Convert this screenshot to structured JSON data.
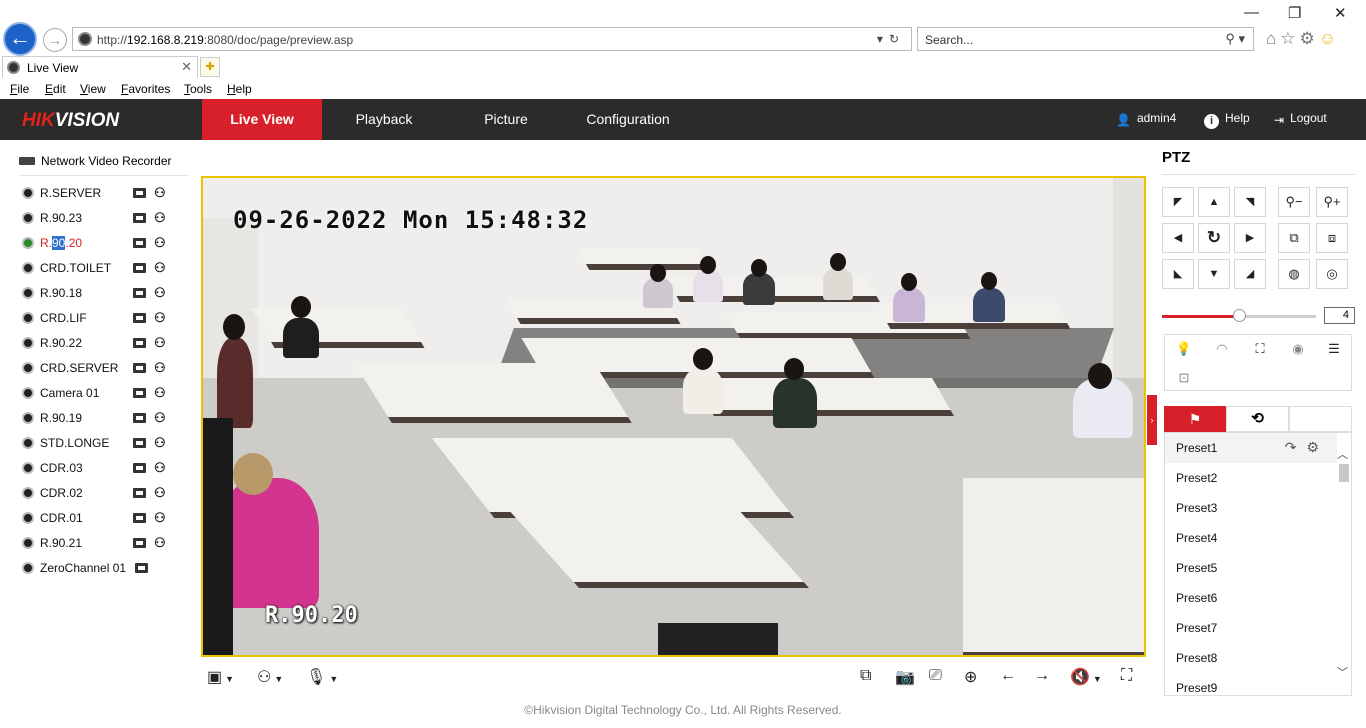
{
  "browser": {
    "url_prefix": "http://",
    "url_host": "192.168.8.219",
    "url_rest": ":8080/doc/page/preview.asp",
    "search_placeholder": "Search...",
    "tab_title": "Live View",
    "menu": [
      "File",
      "Edit",
      "View",
      "Favorites",
      "Tools",
      "Help"
    ]
  },
  "header": {
    "logo_red": "HIK",
    "logo_white": "VISION",
    "nav": [
      "Live View",
      "Playback",
      "Picture",
      "Configuration"
    ],
    "active_nav": "Live View",
    "user": "admin4",
    "help": "Help",
    "logout": "Logout",
    "brand_color": "#d8202a"
  },
  "devices": {
    "root": "Network Video Recorder",
    "channels": [
      {
        "name": "R.SERVER"
      },
      {
        "name": "R.90.23"
      },
      {
        "name_a": "R.",
        "name_b": "90",
        "name_c": ".20",
        "active": true
      },
      {
        "name": "CRD.TOILET"
      },
      {
        "name": "R.90.18"
      },
      {
        "name": "CRD.LIF"
      },
      {
        "name": "R.90.22"
      },
      {
        "name": "CRD.SERVER"
      },
      {
        "name": "Camera 01"
      },
      {
        "name": "R.90.19"
      },
      {
        "name": "STD.LONGE"
      },
      {
        "name": "CDR.03"
      },
      {
        "name": "CDR.02"
      },
      {
        "name": "CDR.01"
      },
      {
        "name": "R.90.21"
      },
      {
        "name": "ZeroChannel 01"
      }
    ]
  },
  "video": {
    "osd_time": "09-26-2022 Mon 15:48:32",
    "osd_name": "R.90.20"
  },
  "footer": "©Hikvision Digital Technology Co., Ltd. All Rights Reserved.",
  "ptz": {
    "title": "PTZ",
    "speed": "4",
    "speed_fraction": 0.5,
    "presets": [
      "Preset1",
      "Preset2",
      "Preset3",
      "Preset4",
      "Preset5",
      "Preset6",
      "Preset7",
      "Preset8",
      "Preset9"
    ],
    "selected_preset": "Preset1"
  }
}
